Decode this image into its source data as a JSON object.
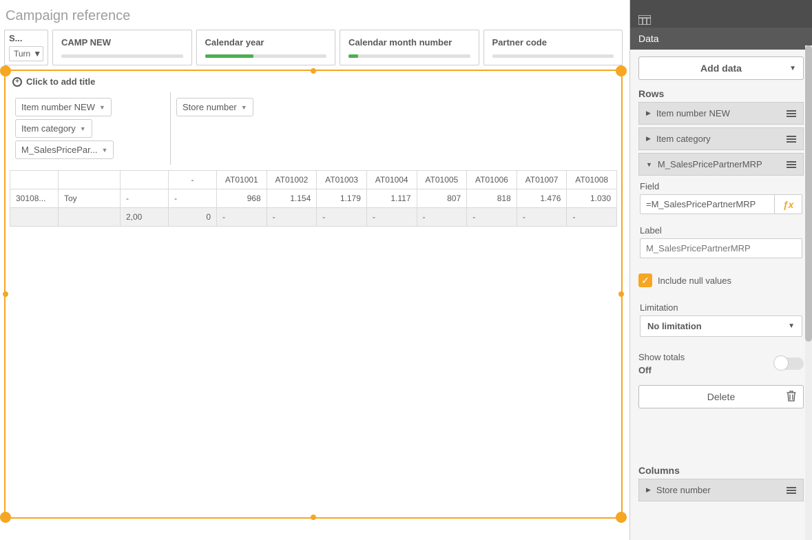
{
  "title": "Campaign reference",
  "filters": {
    "small": {
      "header": "S...",
      "selected": "Turn"
    },
    "boxes": [
      {
        "label": "CAMP NEW",
        "fill": 0
      },
      {
        "label": "Calendar year",
        "fill": 40
      },
      {
        "label": "Calendar month number",
        "fill": 8
      },
      {
        "label": "Partner code",
        "fill": 0
      }
    ]
  },
  "addTitle": "Click to add title",
  "dimChips": [
    "Item number NEW",
    "Item category",
    "M_SalesPricePar..."
  ],
  "measChips": [
    "Store number"
  ],
  "grid": {
    "cornerDash": "-",
    "colHeaders": [
      "AT01001",
      "AT01002",
      "AT01003",
      "AT01004",
      "AT01005",
      "AT01006",
      "AT01007",
      "AT01008"
    ],
    "row1": {
      "a": "30108...",
      "b": "Toy",
      "c": "-",
      "corner": "-",
      "vals": [
        "968",
        "1.154",
        "1.179",
        "1.117",
        "807",
        "818",
        "1.476",
        "1.030"
      ]
    },
    "row2": {
      "a": "",
      "b": "",
      "c": "2,00",
      "corner": "0",
      "vals": [
        "-",
        "-",
        "-",
        "-",
        "-",
        "-",
        "-",
        "-"
      ]
    }
  },
  "panel": {
    "dataTab": "Data",
    "addData": "Add data",
    "rowsLabel": "Rows",
    "rowItems": [
      {
        "label": "Item number NEW",
        "open": false
      },
      {
        "label": "Item category",
        "open": false
      },
      {
        "label": "M_SalesPricePartnerMRP",
        "open": true
      }
    ],
    "field": {
      "label": "Field",
      "value": "=M_SalesPricePartnerMRP"
    },
    "labelField": {
      "label": "Label",
      "placeholder": "M_SalesPricePartnerMRP"
    },
    "includeNull": "Include null values",
    "limitation": {
      "label": "Limitation",
      "value": "No limitation"
    },
    "showTotals": {
      "label": "Show totals",
      "state": "Off"
    },
    "delete": "Delete",
    "columnsLabel": "Columns",
    "colItems": [
      {
        "label": "Store number",
        "open": false
      }
    ]
  }
}
